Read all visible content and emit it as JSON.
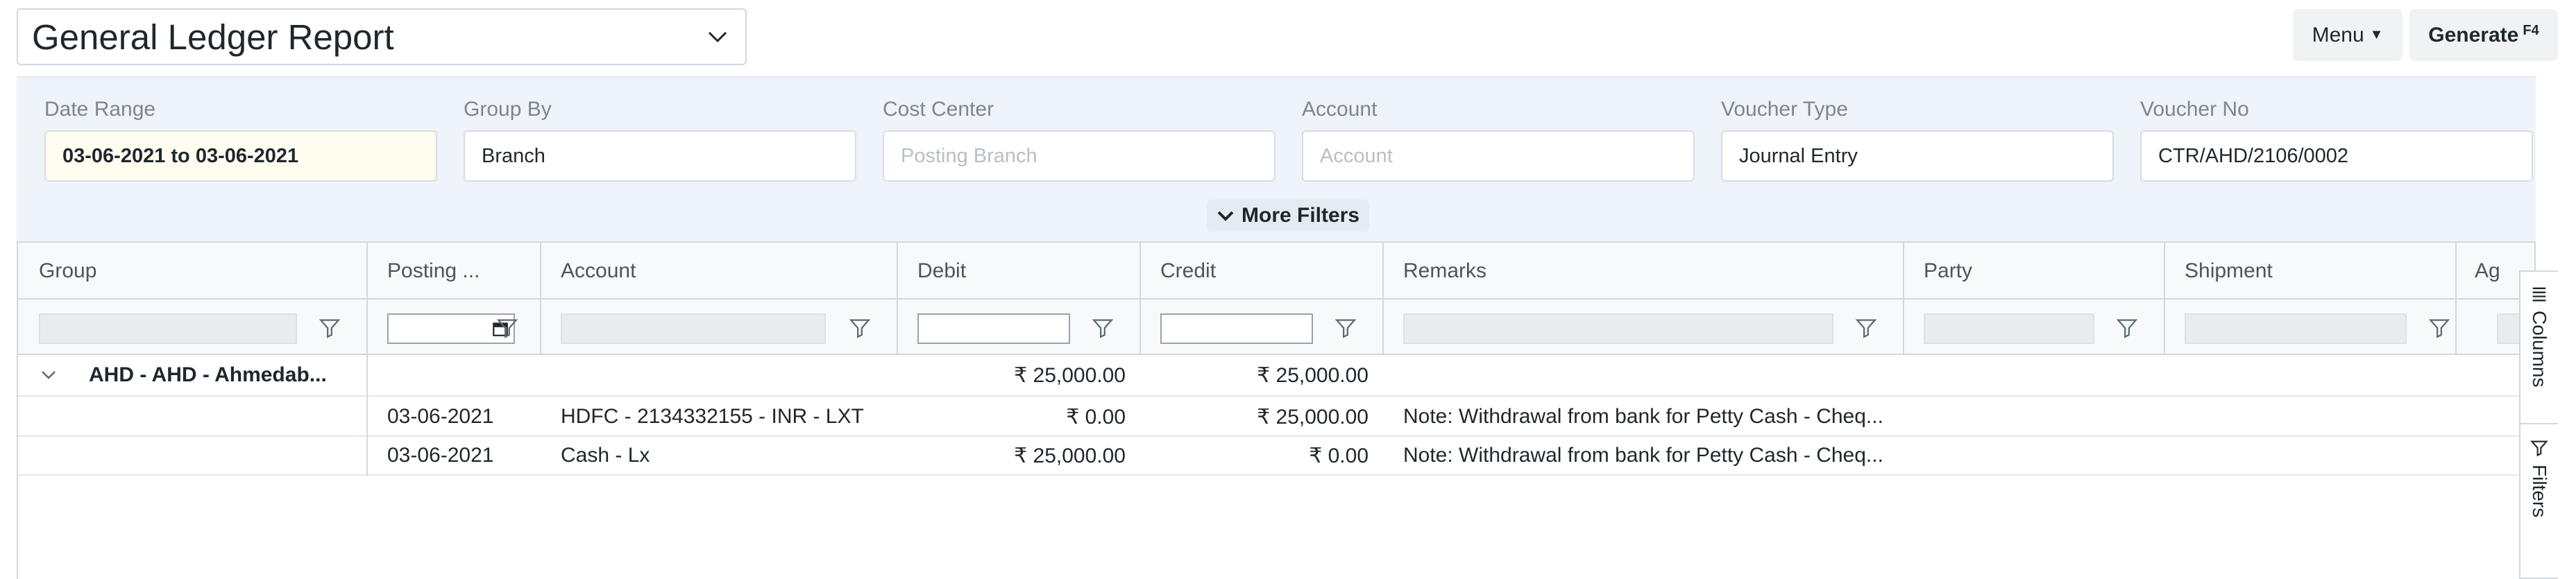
{
  "header": {
    "report_title": "General Ledger Report",
    "menu_label": "Menu",
    "generate_label": "Generate",
    "generate_shortcut": "F4"
  },
  "filters": {
    "date_range": {
      "label": "Date Range",
      "value": "03-06-2021 to 03-06-2021"
    },
    "group_by": {
      "label": "Group By",
      "value": "Branch"
    },
    "cost_center": {
      "label": "Cost Center",
      "placeholder": "Posting Branch"
    },
    "account": {
      "label": "Account",
      "placeholder": "Account"
    },
    "voucher_type": {
      "label": "Voucher Type",
      "value": "Journal Entry"
    },
    "voucher_no": {
      "label": "Voucher No",
      "value": "CTR/AHD/2106/0002"
    },
    "more_filters_label": "More Filters"
  },
  "grid": {
    "columns": [
      "Group",
      "Posting ...",
      "Account",
      "Debit",
      "Credit",
      "Remarks",
      "Party",
      "Shipment",
      "Ag"
    ],
    "group_row": {
      "label": "AHD - AHD - Ahmedab...",
      "debit": "₹ 25,000.00",
      "credit": "₹ 25,000.00"
    },
    "rows": [
      {
        "posting_date": "03-06-2021",
        "account": "HDFC - 2134332155 - INR - LXT",
        "debit": "₹ 0.00",
        "credit": "₹ 25,000.00",
        "remarks": "Note: Withdrawal from bank for Petty Cash - Cheq..."
      },
      {
        "posting_date": "03-06-2021",
        "account": "Cash - Lx",
        "debit": "₹ 25,000.00",
        "credit": "₹ 0.00",
        "remarks": "Note: Withdrawal from bank for Petty Cash - Cheq..."
      }
    ]
  },
  "side_tabs": {
    "columns_label": "Columns",
    "filters_label": "Filters"
  }
}
